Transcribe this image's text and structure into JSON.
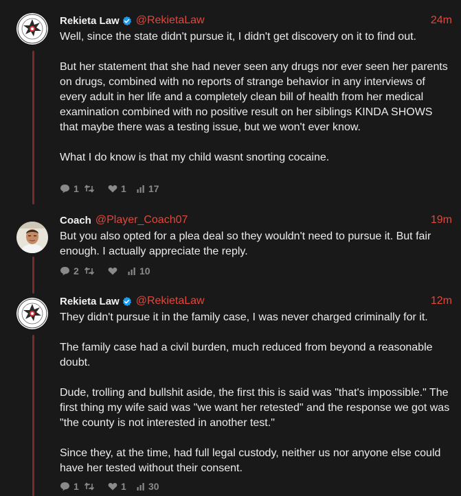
{
  "tweets": [
    {
      "name": "Rekieta Law",
      "handle": "@RekietaLaw",
      "time": "24m",
      "paragraphs": [
        "Well, since the state didn't pursue it, I didn't get discovery on it to find out.",
        "But her statement that she had never seen any drugs nor ever seen her parents on drugs, combined with no reports of strange behavior in any interviews of every adult in her life and a completely clean bill of health from her medical examination combined with no positive result on her siblings KINDA SHOWS that maybe there was a testing issue, but we won't ever know.",
        "What I do know is that my child wasnt snorting cocaine."
      ],
      "stats": {
        "replies": "1",
        "retweets": "",
        "likes": "1",
        "views": "17"
      }
    },
    {
      "name": "Coach",
      "handle": "@Player_Coach07",
      "time": "19m",
      "paragraphs": [
        "But you also opted for a plea deal so they wouldn't need to pursue it. But fair enough. I actually appreciate the reply."
      ],
      "stats": {
        "replies": "2",
        "retweets": "",
        "likes": "",
        "views": "10"
      }
    },
    {
      "name": "Rekieta Law",
      "handle": "@RekietaLaw",
      "time": "12m",
      "paragraphs": [
        "They didn't pursue it in the family case, I was never charged criminally for it.",
        "The family case had a civil burden, much reduced from beyond a reasonable doubt.",
        "Dude, trolling and bullshit aside, the first this is said was \"that's impossible.\" The first thing my wife said was \"we want her retested\" and the response we got was \"the county is not interested in another test.\"",
        "Since they, at the time, had full legal custody, neither us nor anyone else could have her tested without their consent."
      ],
      "stats": {
        "replies": "1",
        "retweets": "",
        "likes": "1",
        "views": "30"
      }
    }
  ],
  "colors": {
    "background": "#191919",
    "accent": "#e0483d",
    "thread_line": "#7a2a2a",
    "verified": "#1d9bf0",
    "muted": "#8a8a8a"
  },
  "icons": [
    "badge-avatar-icon",
    "verified-icon",
    "reply-icon",
    "retweet-icon",
    "like-icon",
    "views-icon"
  ]
}
